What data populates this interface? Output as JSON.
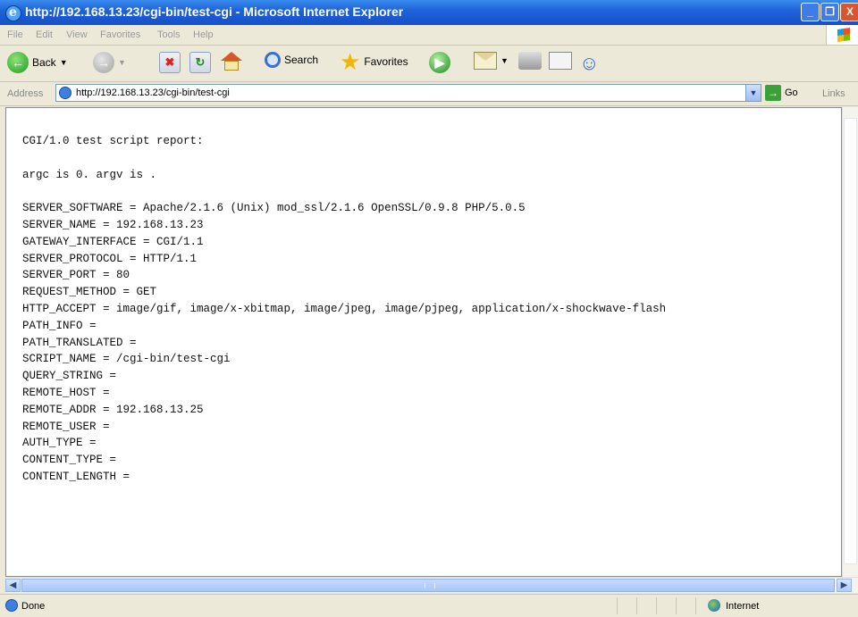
{
  "window": {
    "title": "http://192.168.13.23/cgi-bin/test-cgi - Microsoft Internet Explorer",
    "minimize": "_",
    "maximize": "❐",
    "close": "X"
  },
  "menu": [
    "File",
    "Edit",
    "View",
    "Favorites",
    "Tools",
    "Help"
  ],
  "toolbar": {
    "back_label": "Back",
    "search_label": "Search",
    "favorites_label": "Favorites"
  },
  "address": {
    "label": "Address",
    "url": "http://192.168.13.23/cgi-bin/test-cgi",
    "go_label": "Go",
    "links_label": "Links"
  },
  "page": {
    "lines": [
      "CGI/1.0 test script report:",
      "",
      "argc is 0. argv is .",
      "",
      "SERVER_SOFTWARE = Apache/2.1.6 (Unix) mod_ssl/2.1.6 OpenSSL/0.9.8 PHP/5.0.5",
      "SERVER_NAME = 192.168.13.23",
      "GATEWAY_INTERFACE = CGI/1.1",
      "SERVER_PROTOCOL = HTTP/1.1",
      "SERVER_PORT = 80",
      "REQUEST_METHOD = GET",
      "HTTP_ACCEPT = image/gif, image/x-xbitmap, image/jpeg, image/pjpeg, application/x-shockwave-flash",
      "PATH_INFO =",
      "PATH_TRANSLATED =",
      "SCRIPT_NAME = /cgi-bin/test-cgi",
      "QUERY_STRING =",
      "REMOTE_HOST =",
      "REMOTE_ADDR = 192.168.13.25",
      "REMOTE_USER =",
      "AUTH_TYPE =",
      "CONTENT_TYPE =",
      "CONTENT_LENGTH ="
    ]
  },
  "status": {
    "text": "Done",
    "zone": "Internet"
  }
}
